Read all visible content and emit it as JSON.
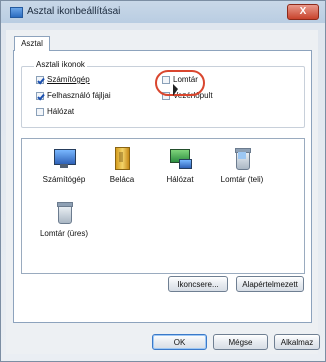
{
  "window": {
    "title": "Asztal ikonbeállításai",
    "close_label": "X"
  },
  "tabs": [
    {
      "label": "Asztal"
    }
  ],
  "group": {
    "title": "Asztali ikonok",
    "checkboxes": [
      {
        "label": "Számítógép",
        "checked": true
      },
      {
        "label": "Felhasználó fájljai",
        "checked": true
      },
      {
        "label": "Hálózat",
        "checked": false
      },
      {
        "label": "Lomtár",
        "checked": false
      },
      {
        "label": "Vezérlőpult",
        "checked": false
      }
    ]
  },
  "icons": [
    {
      "label": "Számítógép",
      "icon": "computer-icon"
    },
    {
      "label": "Beláca",
      "icon": "user-folder-icon"
    },
    {
      "label": "Hálózat",
      "icon": "network-icon"
    },
    {
      "label": "Lomtár (teli)",
      "icon": "recycle-bin-full-icon"
    },
    {
      "label": "Lomtár (üres)",
      "icon": "recycle-bin-empty-icon"
    }
  ],
  "buttons": {
    "change_icon": "Ikoncsere...",
    "default": "Alapértelmezett",
    "ok": "OK",
    "cancel": "Mégse",
    "apply": "Alkalmaz"
  },
  "colors": {
    "highlight_circle": "#d9462e",
    "accent": "#3b79c8"
  }
}
